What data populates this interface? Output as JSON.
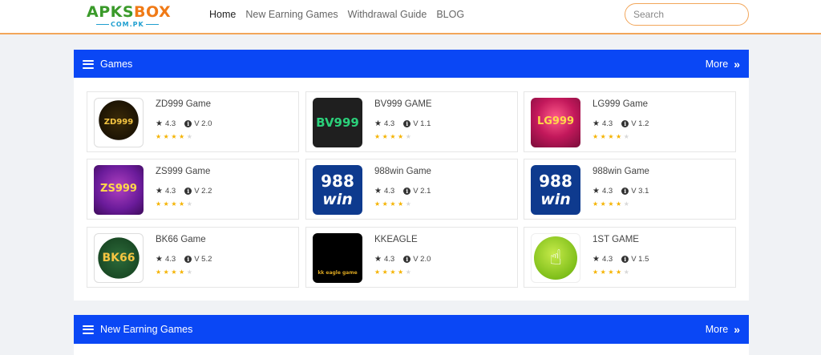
{
  "logo": {
    "main_green": "APKS",
    "main_orange": "BOX",
    "sub": "COM.PK"
  },
  "nav": {
    "items": [
      "Home",
      "New Earning Games",
      "Withdrawal Guide",
      "BLOG"
    ],
    "active": "Home"
  },
  "search": {
    "placeholder": "Search",
    "value": ""
  },
  "colors": {
    "accent": "#0a47f5",
    "header_border": "#f2a65a",
    "star": "#f5b301"
  },
  "games_section": {
    "title": "Games",
    "more": "More"
  },
  "new_section": {
    "title": "New Earning Games",
    "more": "More"
  },
  "games": [
    {
      "name": "ZD999 Game",
      "rating": "4.3",
      "version": "V 2.0",
      "stars": 4,
      "icon": "zd999-game-icon",
      "art": "ZD999"
    },
    {
      "name": "BV999 GAME",
      "rating": "4.3",
      "version": "V 1.1",
      "stars": 4,
      "icon": "bv999-game-icon",
      "art": "BV999"
    },
    {
      "name": "LG999 Game",
      "rating": "4.3",
      "version": "V 1.2",
      "stars": 4,
      "icon": "lg999-game-icon",
      "art": "LG999"
    },
    {
      "name": "ZS999 Game",
      "rating": "4.3",
      "version": "V 2.2",
      "stars": 4,
      "icon": "zs999-game-icon",
      "art": "ZS999"
    },
    {
      "name": "988win Game",
      "rating": "4.3",
      "version": "V 2.1",
      "stars": 4,
      "icon": "988win-game-icon",
      "art": "988"
    },
    {
      "name": "988win Game",
      "rating": "4.3",
      "version": "V 3.1",
      "stars": 4,
      "icon": "988win-game-icon",
      "art": "988"
    },
    {
      "name": "BK66 Game",
      "rating": "4.3",
      "version": "V 5.2",
      "stars": 4,
      "icon": "bk66-game-icon",
      "art": "BK66"
    },
    {
      "name": "KKEAGLE",
      "rating": "4.3",
      "version": "V 2.0",
      "stars": 4,
      "icon": "kkeagle-game-icon",
      "art": "kk eagle game"
    },
    {
      "name": "1ST GAME",
      "rating": "4.3",
      "version": "V 1.5",
      "stars": 4,
      "icon": "1st-game-icon",
      "art": ""
    }
  ]
}
